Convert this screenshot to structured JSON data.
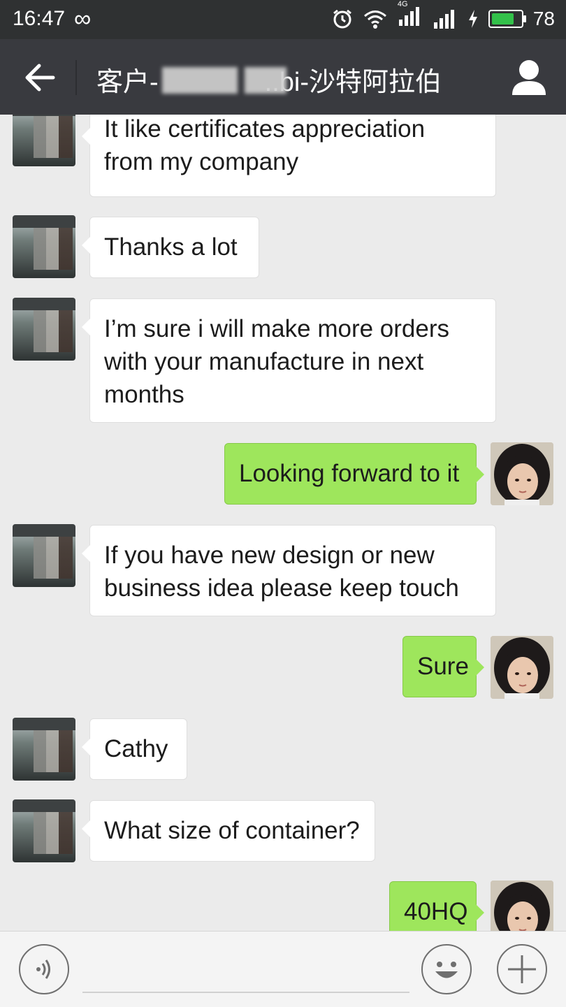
{
  "status_bar": {
    "time": "16:47",
    "infinity": "∞",
    "network": "4G",
    "battery": "78",
    "battery_level": 0.78,
    "battery_color": "#33c14a"
  },
  "header": {
    "title": "客户-        ..bi-沙特阿拉伯",
    "title_prefix": "客户-",
    "title_suffix": "..bi-沙特阿拉伯"
  },
  "colors": {
    "outgoing_bubble": "#9ee65c",
    "incoming_bubble": "#ffffff",
    "chat_background": "#ebebeb",
    "title_bar": "#393a3f"
  },
  "messages": [
    {
      "side": "in",
      "text_lines": [
        "It like certificates appreciation",
        "from my company"
      ]
    },
    {
      "side": "in",
      "text_lines": [
        "Thanks a lot"
      ]
    },
    {
      "side": "in",
      "text_lines": [
        "I’m sure i will make more orders",
        "with your manufacture in next",
        "months"
      ]
    },
    {
      "side": "out",
      "text_lines": [
        "Looking forward to it"
      ]
    },
    {
      "side": "in",
      "text_lines": [
        "If you have new design or new",
        "business idea please keep touch"
      ]
    },
    {
      "side": "out",
      "text_lines": [
        "Sure"
      ]
    },
    {
      "side": "in",
      "text_lines": [
        "Cathy"
      ]
    },
    {
      "side": "in",
      "text_lines": [
        "What size of container?"
      ]
    },
    {
      "side": "out",
      "text_lines": [
        "40HQ"
      ]
    }
  ],
  "input_bar": {
    "left_icon": "voice-icon",
    "emoji_icon": "emoji-icon",
    "plus_icon": "plus-icon"
  }
}
